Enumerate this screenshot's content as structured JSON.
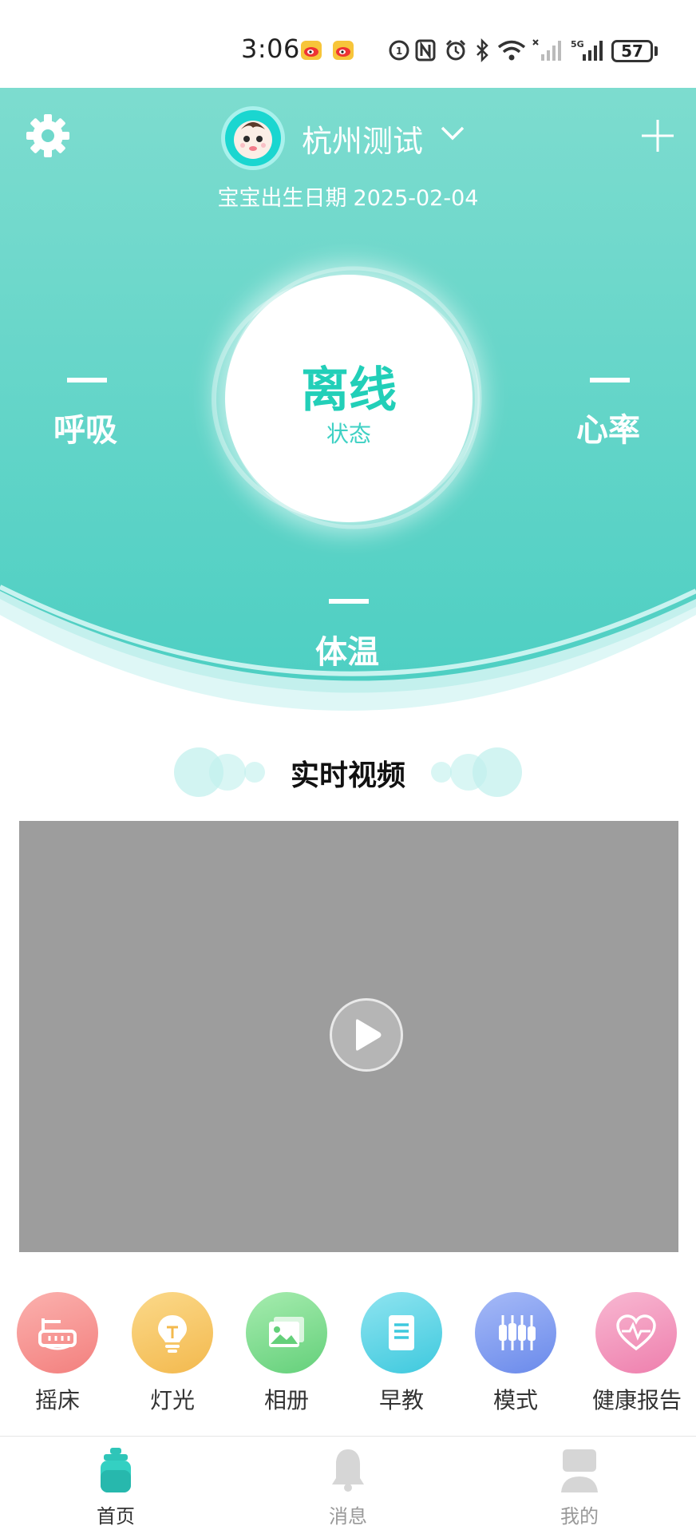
{
  "status_bar": {
    "time": "3:06",
    "battery": "57",
    "network": "5G"
  },
  "header": {
    "child_name": "杭州测试",
    "birthday_label": "宝宝出生日期",
    "birthday_date": "2025-02-04"
  },
  "status": {
    "value": "离线",
    "label": "状态"
  },
  "metrics": {
    "breathing": {
      "value": "--",
      "label": "呼吸"
    },
    "heart_rate": {
      "value": "--",
      "label": "心率"
    },
    "temperature": {
      "value": "--",
      "label": "体温"
    }
  },
  "video": {
    "title": "实时视频"
  },
  "functions": [
    {
      "label": "摇床",
      "icon": "cradle-icon",
      "color": "#f58e8e"
    },
    {
      "label": "灯光",
      "icon": "bulb-icon",
      "color": "#f6c462"
    },
    {
      "label": "相册",
      "icon": "photo-album-icon",
      "color": "#7edc8d"
    },
    {
      "label": "早教",
      "icon": "document-icon",
      "color": "#5ed3e4"
    },
    {
      "label": "模式",
      "icon": "sliders-icon",
      "color": "#7f9df1"
    },
    {
      "label": "健康报告",
      "icon": "heart-pulse-icon",
      "color": "#f298bd"
    }
  ],
  "bottom_nav": [
    {
      "label": "首页",
      "icon": "home-bottle-icon",
      "active": true
    },
    {
      "label": "消息",
      "icon": "bell-icon",
      "active": false
    },
    {
      "label": "我的",
      "icon": "user-icon",
      "active": false
    }
  ],
  "colors": {
    "teal_top": "#7ddccf",
    "teal_bottom": "#4ecfc3",
    "accent": "#22cfb8"
  }
}
